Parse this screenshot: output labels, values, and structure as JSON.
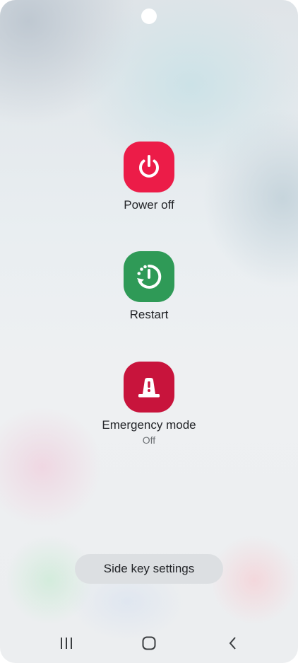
{
  "power_menu": {
    "power_off": {
      "label": "Power off",
      "icon": "power-icon",
      "color": "#ec1c48"
    },
    "restart": {
      "label": "Restart",
      "icon": "restart-icon",
      "color": "#2f9a57"
    },
    "emergency_mode": {
      "label": "Emergency mode",
      "status": "Off",
      "icon": "emergency-siren-icon",
      "color": "#c8143c"
    }
  },
  "side_key_settings": {
    "label": "Side key settings"
  },
  "navigation_bar": {
    "recent_apps": {
      "icon": "recent-apps-icon"
    },
    "home": {
      "icon": "home-icon"
    },
    "back": {
      "icon": "back-icon"
    }
  }
}
